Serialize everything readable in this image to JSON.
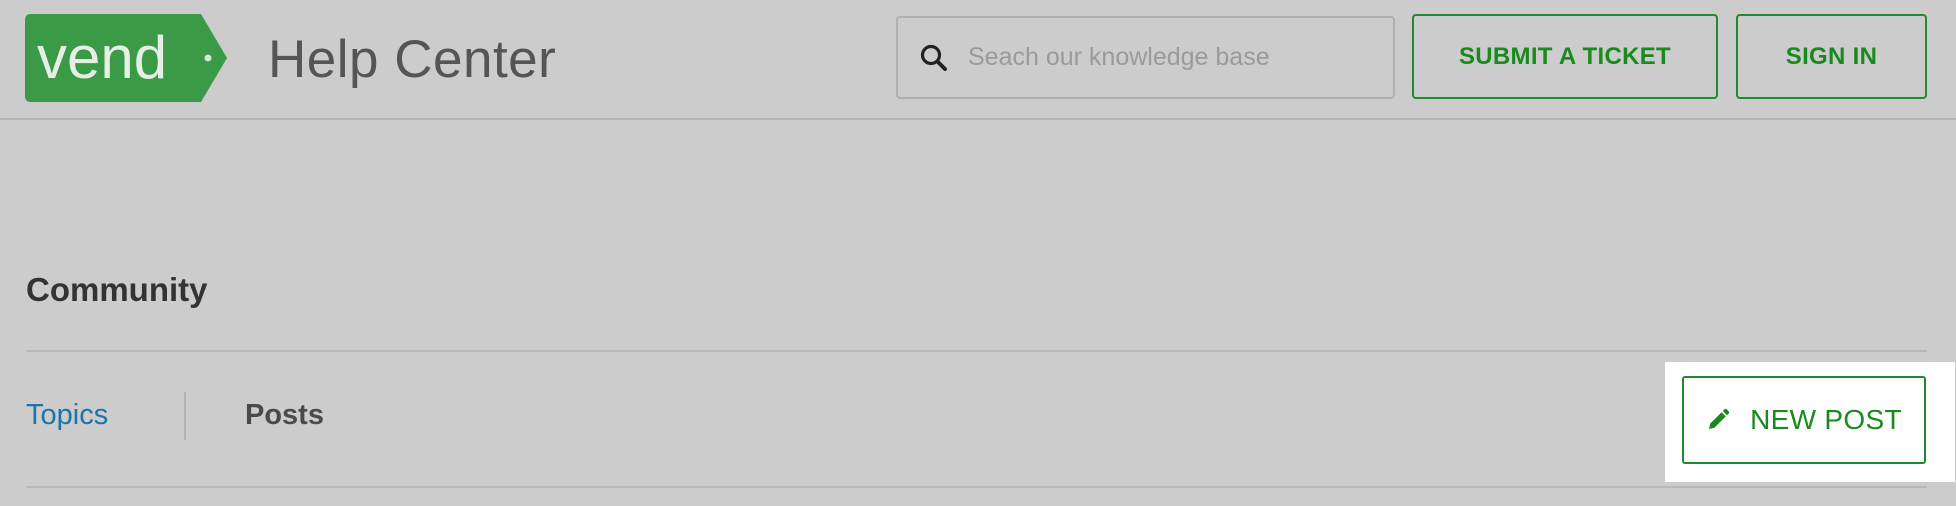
{
  "header": {
    "logo_text": "vend",
    "title": "Help Center",
    "search": {
      "placeholder": "Seach our knowledge base",
      "value": ""
    },
    "submit_ticket_label": "SUBMIT A TICKET",
    "sign_in_label": "SIGN IN"
  },
  "community": {
    "title": "Community",
    "tabs": [
      {
        "label": "Topics",
        "active": true
      },
      {
        "label": "Posts",
        "active": false
      }
    ],
    "new_post_label": "NEW POST"
  },
  "colors": {
    "background": "#cccccc",
    "brand_green": "#3a9a46",
    "accent_green": "#1a8a1f",
    "link_blue": "#1f73a8"
  },
  "icons": {
    "search": "search-icon",
    "new_post": "pencil-icon"
  }
}
